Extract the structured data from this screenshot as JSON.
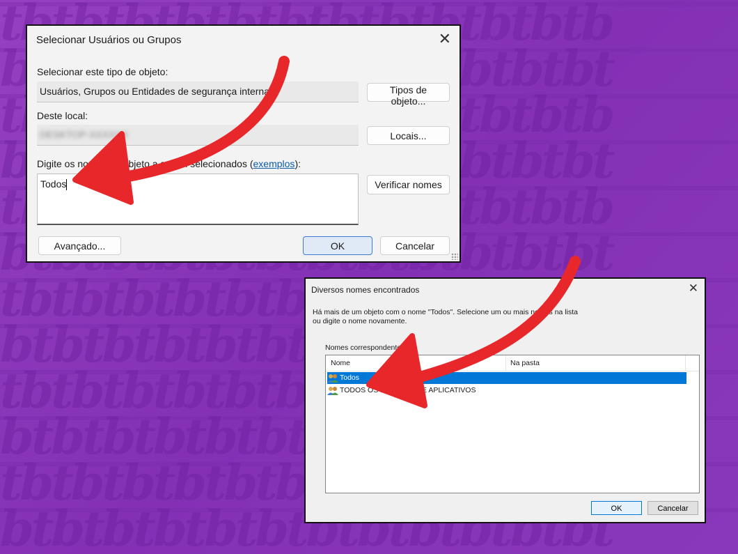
{
  "background_color": "#8a35b8",
  "dialog_select": {
    "title": "Selecionar Usuários ou Grupos",
    "object_type_label": "Selecionar este tipo de objeto:",
    "object_type_value": "Usuários, Grupos ou Entidades de segurança interna",
    "object_types_button": "Tipos de objeto...",
    "location_label": "Deste local:",
    "location_value": "DESKTOP-XXXXXX",
    "locations_button": "Locais...",
    "names_label_prefix": "Digite os nomes de objeto a serem selecionados (",
    "names_label_link": "exemplos",
    "names_label_suffix": "):",
    "names_value": "Todos",
    "check_names_button": "Verificar nomes",
    "advanced_button": "Avançado...",
    "ok_button": "OK",
    "cancel_button": "Cancelar"
  },
  "dialog_multiple": {
    "title": "Diversos nomes encontrados",
    "message": "Há mais de um objeto com o nome \"Todos\". Selecione um ou mais nomes na lista ou digite o nome novamente.",
    "group_label": "Nomes correspondentes:",
    "columns": [
      "Nome",
      "Na pasta"
    ],
    "rows": [
      {
        "name": "Todos",
        "folder": "",
        "selected": true,
        "icon": "users-icon"
      },
      {
        "name": "TODOS OS PACOTES DE APLICATIVOS",
        "folder": "",
        "selected": false,
        "icon": "users-icon"
      }
    ],
    "ok_button": "OK",
    "cancel_button": "Cancelar"
  },
  "accent_color": "#e8272b"
}
